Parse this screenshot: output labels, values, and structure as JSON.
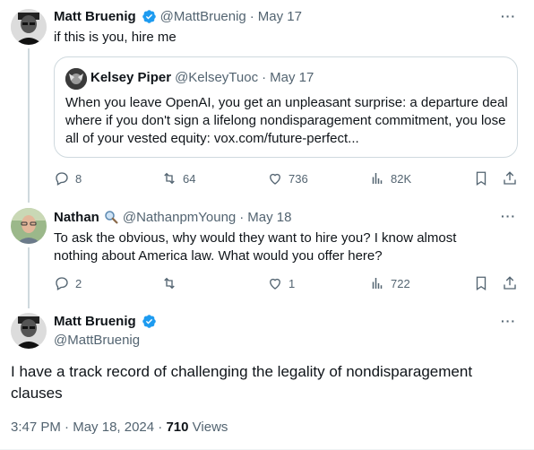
{
  "tweet1": {
    "name": "Matt Bruenig",
    "handle": "@MattBruenig",
    "sep": "·",
    "date": "May 17",
    "text": "if this is you, hire me",
    "quote": {
      "name": "Kelsey Piper",
      "handle": "@KelseyTuoc",
      "sep": "·",
      "date": "May 17",
      "text": "When you leave OpenAI, you get an unpleasant surprise: a departure deal where if you don't sign a lifelong nondisparagement commitment, you lose all of your vested equity: vox.com/future-perfect..."
    },
    "actions": {
      "replies": "8",
      "retweets": "64",
      "likes": "736",
      "views": "82K"
    }
  },
  "tweet2": {
    "name": "Nathan",
    "handle": "@NathanpmYoung",
    "sep": "·",
    "date": "May 18",
    "text": "To ask the obvious, why would they want to hire you? I know almost nothing about America law. What would you offer here?",
    "actions": {
      "replies": "2",
      "retweets": "",
      "likes": "1",
      "views": "722"
    }
  },
  "main": {
    "name": "Matt Bruenig",
    "handle": "@MattBruenig",
    "text": "I have a track record of challenging the legality of nondisparagement clauses",
    "time": "3:47 PM",
    "sep1": "·",
    "date": "May 18, 2024",
    "sep2": "·",
    "views_count": "710",
    "views_label": "Views"
  },
  "more_label": "···",
  "colors": {
    "verified": "#1d9bf0",
    "muted": "#536471",
    "border": "#cfd9de"
  },
  "icons": [
    "verified-badge",
    "reply-icon",
    "retweet-icon",
    "like-icon",
    "views-icon",
    "bookmark-icon",
    "share-icon",
    "magnifier-icon",
    "more-icon"
  ]
}
